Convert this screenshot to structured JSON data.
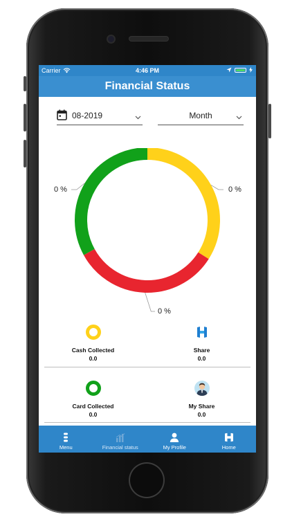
{
  "status_bar": {
    "carrier": "Carrier",
    "time": "4:46 PM"
  },
  "header": {
    "title": "Financial Status"
  },
  "filters": {
    "date_value": "08-2019",
    "period_value": "Month"
  },
  "chart_data": {
    "type": "pie",
    "categories": [
      "Yellow segment",
      "Red segment",
      "Green segment"
    ],
    "values": [
      34,
      33,
      33
    ],
    "slice_labels": [
      "0 %",
      "0 %",
      "0 %"
    ],
    "colors": [
      "#ffd11a",
      "#e8252f",
      "#11a11a"
    ]
  },
  "stats": [
    {
      "label": "Cash Collected",
      "value": "0.0"
    },
    {
      "label": "Share",
      "value": "0.0"
    },
    {
      "label": "Card Collected",
      "value": "0.0"
    },
    {
      "label": "My Share",
      "value": "0.0"
    }
  ],
  "tabs": [
    {
      "label": "Menu"
    },
    {
      "label": "Financial status"
    },
    {
      "label": "My Profile"
    },
    {
      "label": "Home"
    }
  ],
  "colors": {
    "primary": "#2f86c9",
    "header": "#3a8fd0",
    "yellow": "#ffd11a",
    "red": "#e8252f",
    "green": "#11a11a"
  }
}
